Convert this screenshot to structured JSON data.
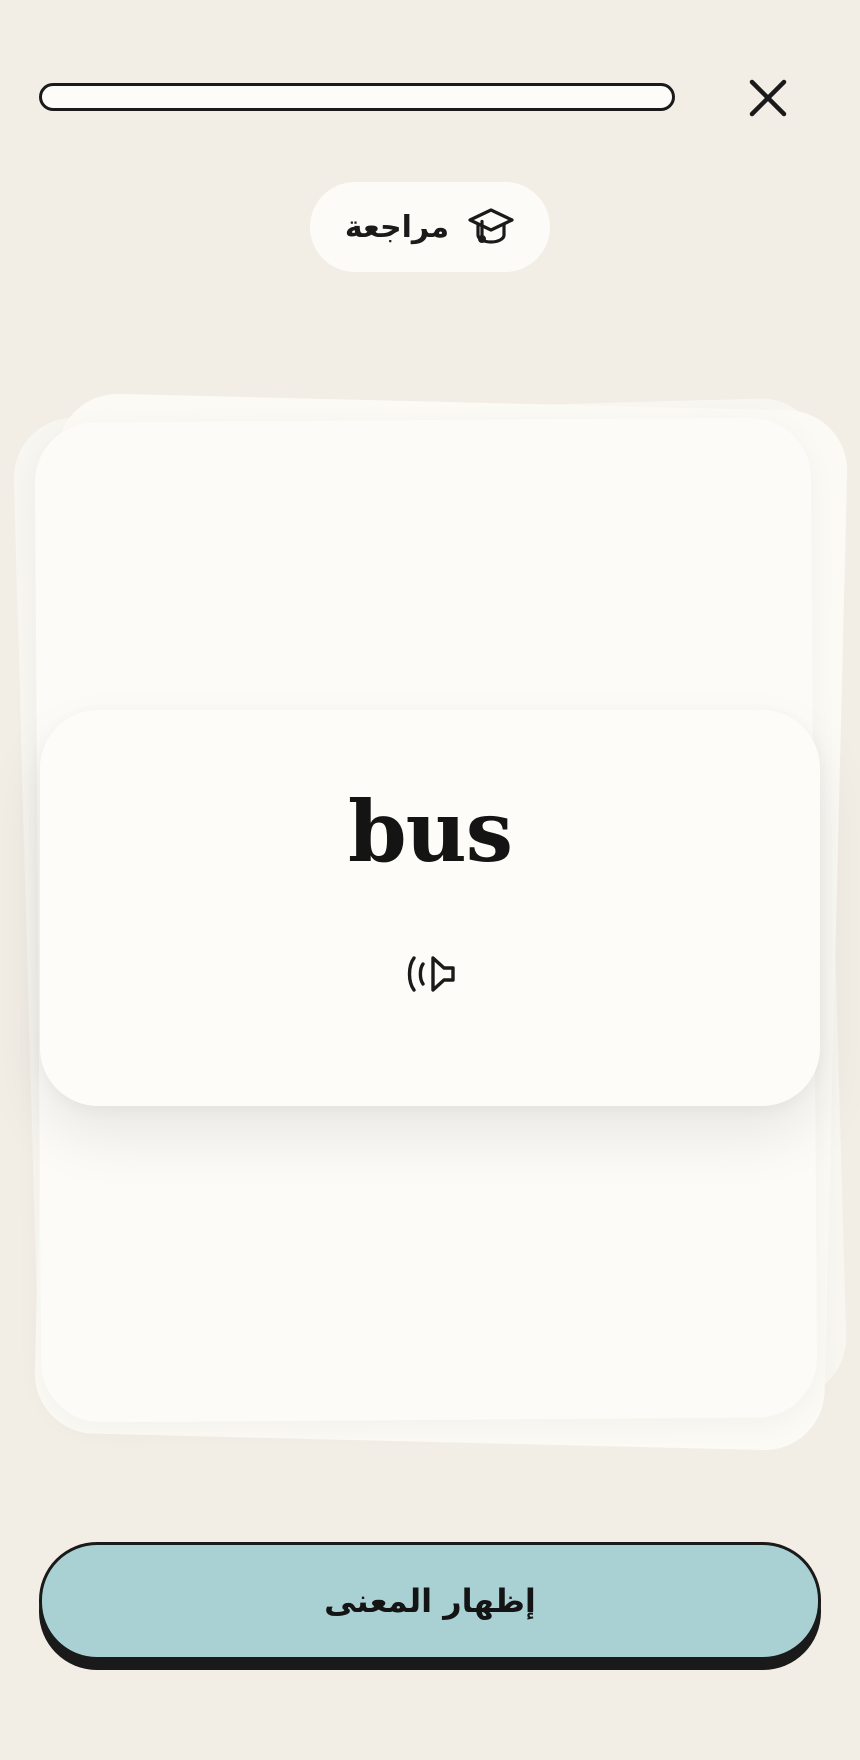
{
  "header": {
    "progress_percent": 0,
    "close_icon": "close-icon"
  },
  "mode": {
    "label": "مراجعة",
    "icon": "graduation-cap-icon"
  },
  "card": {
    "word": "bus",
    "audio_icon": "speaker-icon"
  },
  "actions": {
    "show_meaning_label": "إظهار المعنى"
  },
  "colors": {
    "background": "#f2eee6",
    "card": "#fdfcf8",
    "accent_button": "#a9d1d3",
    "ink": "#1a1a1a"
  }
}
